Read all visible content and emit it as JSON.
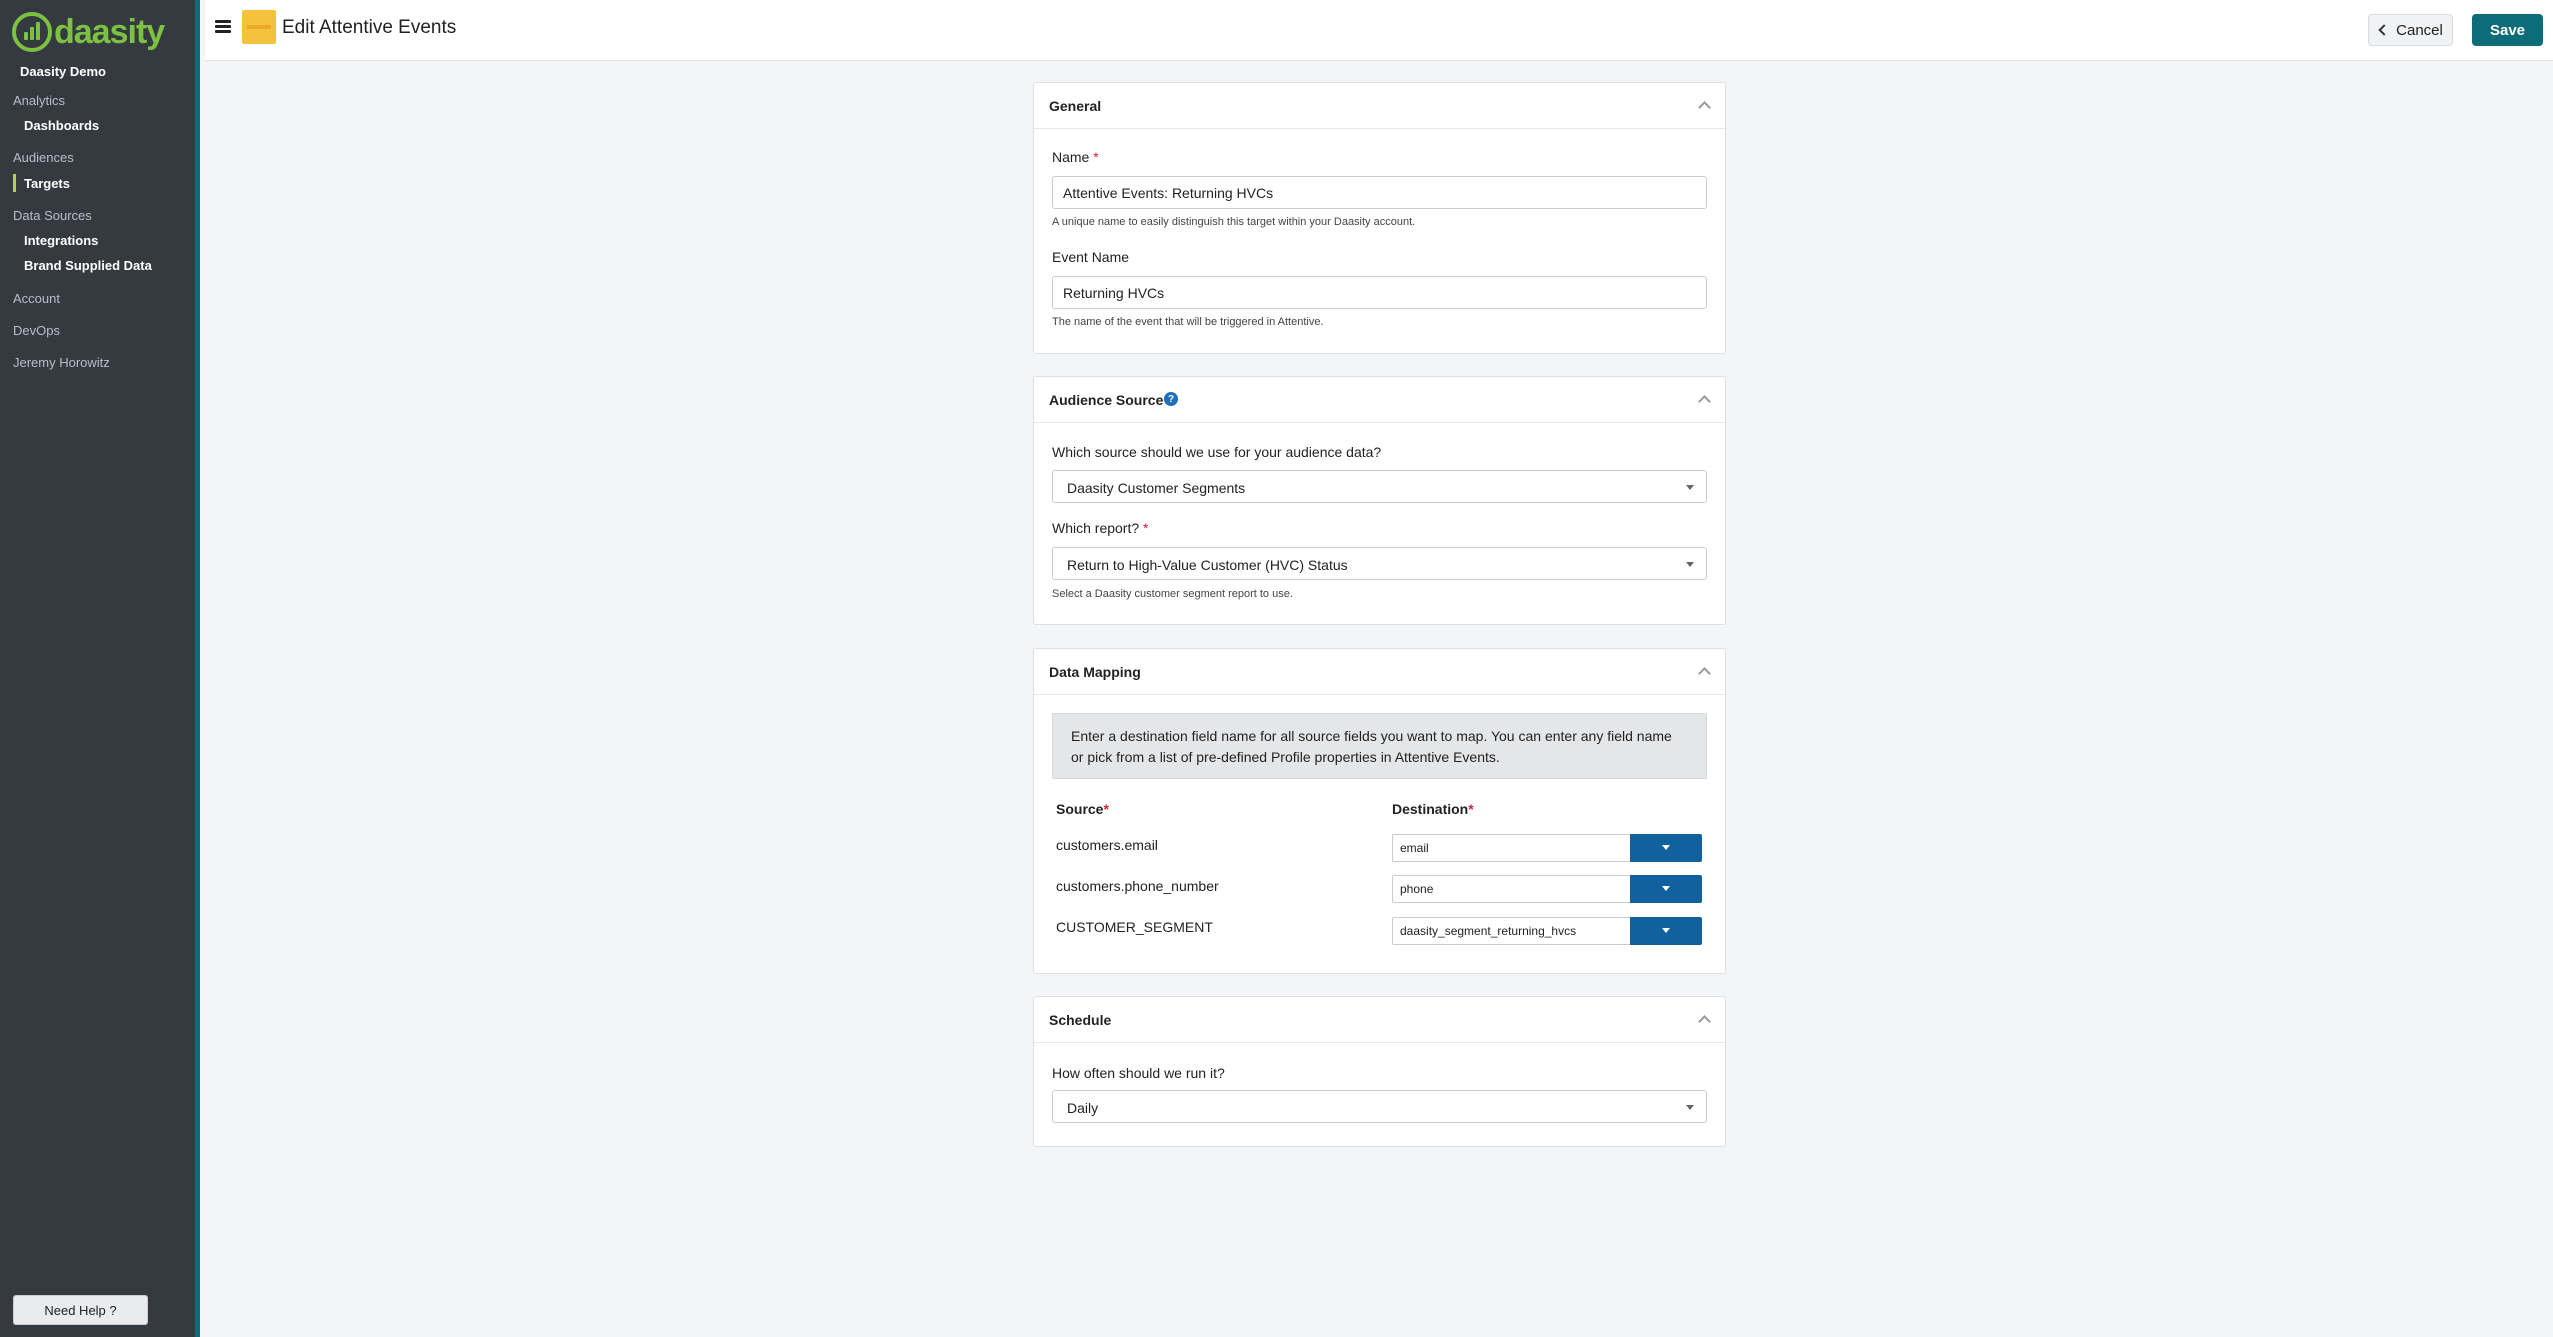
{
  "sidebar": {
    "logo_text": "daasity",
    "org_name": "Daasity Demo",
    "sections": [
      {
        "label": "Analytics",
        "items": [
          "Dashboards"
        ]
      },
      {
        "label": "Audiences",
        "items": [
          "Targets"
        ]
      },
      {
        "label": "Data Sources",
        "items": [
          "Integrations",
          "Brand Supplied Data"
        ]
      },
      {
        "label": "Account",
        "items": []
      },
      {
        "label": "DevOps",
        "items": []
      },
      {
        "label": "Jeremy Horowitz",
        "items": []
      }
    ],
    "active_item": "Targets",
    "accent_color": "#b7d43a",
    "help_button": "Need Help ?"
  },
  "header": {
    "title": "Edit Attentive Events",
    "cancel_label": "Cancel",
    "save_label": "Save"
  },
  "general": {
    "title": "General",
    "name_label": "Name",
    "name_value": "Attentive Events: Returning HVCs",
    "name_help": "A unique name to easily distinguish this target within your Daasity account.",
    "event_label": "Event Name",
    "event_value": "Returning HVCs",
    "event_help": "The name of the event that will be triggered in Attentive."
  },
  "audience": {
    "title": "Audience Source",
    "source_label": "Which source should we use for your audience data?",
    "source_value": "Daasity Customer Segments",
    "report_label": "Which report?",
    "report_value": "Return to High-Value Customer (HVC) Status",
    "report_help": "Select a Daasity customer segment report to use."
  },
  "mapping": {
    "title": "Data Mapping",
    "info": "Enter a destination field name for all source fields you want to map. You can enter any field name or pick from a list of pre-defined Profile properties in Attentive Events.",
    "source_header": "Source",
    "dest_header": "Destination",
    "rows": [
      {
        "source": "customers.email",
        "destination": "email"
      },
      {
        "source": "customers.phone_number",
        "destination": "phone"
      },
      {
        "source": "CUSTOMER_SEGMENT",
        "destination": "daasity_segment_returning_hvcs"
      }
    ]
  },
  "schedule": {
    "title": "Schedule",
    "frequency_label": "How often should we run it?",
    "frequency_value": "Daily"
  },
  "colors": {
    "sidebar_bg": "#353a40",
    "brand_green": "#7cc242",
    "save_button": "#0e6b78",
    "dropdown_button": "#11619f"
  }
}
